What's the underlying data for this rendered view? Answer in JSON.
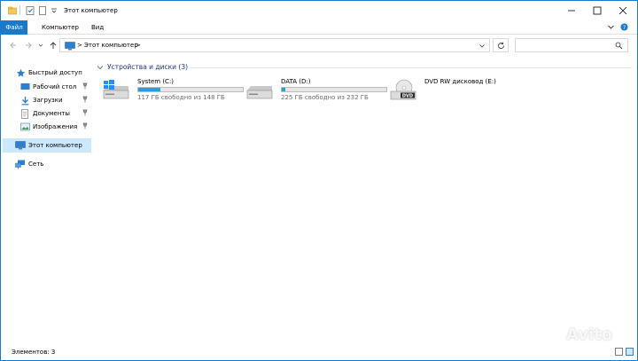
{
  "window": {
    "title": "Этот компьютер"
  },
  "ribbon": {
    "tabs": [
      "Файл",
      "Компьютер",
      "Вид"
    ]
  },
  "address": {
    "path": "Этот компьютер",
    "separator": ">"
  },
  "nav": {
    "quick_access": "Быстрый доступ",
    "items": [
      "Рабочий стол",
      "Загрузки",
      "Документы",
      "Изображения"
    ],
    "this_pc": "Этот компьютер",
    "network": "Сеть"
  },
  "content": {
    "group": "Устройства и диски (3)",
    "drives": [
      {
        "name": "System (C:)",
        "free": "117 ГБ свободно из 148 ГБ",
        "used_fraction": 0.21,
        "icon": "windows-drive-icon"
      },
      {
        "name": "DATA (D:)",
        "free": "225 ГБ свободно из 232 ГБ",
        "used_fraction": 0.03,
        "icon": "hard-drive-icon"
      },
      {
        "name": "DVD RW дисковод (E:)",
        "icon": "dvd-drive-icon"
      }
    ]
  },
  "status": {
    "items": "Элементов: 3"
  },
  "watermark": "Avito",
  "colors": {
    "accent": "#1979ca",
    "bar_fill": "#26a0da",
    "selected": "#cce8ff",
    "group_header": "#1e3287"
  }
}
